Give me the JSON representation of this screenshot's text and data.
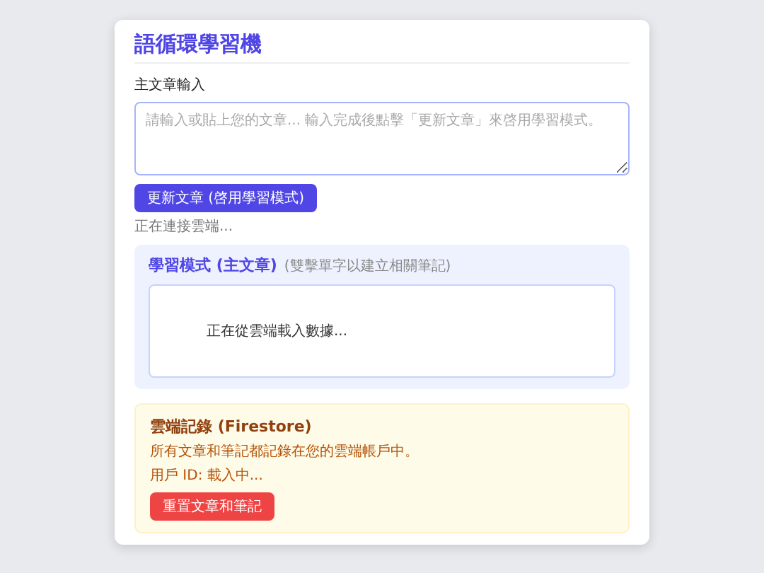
{
  "app": {
    "title": "語循環學習機"
  },
  "input": {
    "label": "主文章輸入",
    "placeholder": "請輸入或貼上您的文章... 輸入完成後點擊「更新文章」來啓用學習模式。",
    "button": "更新文章 (啓用學習模式)",
    "status": "正在連接雲端..."
  },
  "learning": {
    "title": "學習模式 (主文章)",
    "hint": "(雙擊單字以建立相關筆記)",
    "message": "正在從雲端載入數據..."
  },
  "cloud": {
    "title": "雲端記錄 (Firestore)",
    "description": "所有文章和筆記都記錄在您的雲端帳戶中。",
    "user_id": "用戶 ID: 載入中...",
    "button": "重置文章和筆記"
  }
}
